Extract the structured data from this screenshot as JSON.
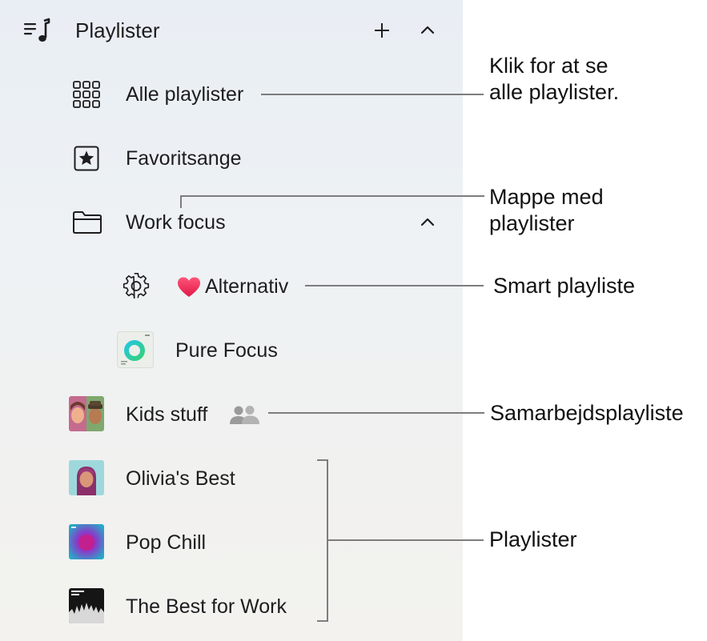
{
  "sidebar": {
    "title": "Playlister",
    "icons": {
      "header": "playlist-music-icon",
      "add": "plus-icon",
      "collapse": "chevron-up-icon"
    },
    "items": [
      {
        "label": "Alle playlister",
        "icon": "grid-icon"
      },
      {
        "label": "Favoritsange",
        "icon": "star-square-icon"
      },
      {
        "label": "Work focus",
        "icon": "folder-icon",
        "expanded": true
      },
      {
        "label": "Alternativ",
        "icon": "gear-icon",
        "badge": "heart-icon"
      },
      {
        "label": "Pure Focus",
        "icon": "pure-focus-artwork"
      },
      {
        "label": "Kids stuff",
        "icon": "kids-artwork",
        "badge": "people-icon"
      },
      {
        "label": "Olivia's Best",
        "icon": "olivia-artwork"
      },
      {
        "label": "Pop Chill",
        "icon": "pop-chill-artwork"
      },
      {
        "label": "The Best for Work",
        "icon": "best-for-work-artwork"
      }
    ]
  },
  "callouts": {
    "all_playlists": "Klik for at se\nalle playlister.",
    "folder": "Mappe med\nplaylister",
    "smart": "Smart playliste",
    "collab": "Samarbejdsplayliste",
    "playlists": "Playlister"
  },
  "colors": {
    "heart": "#f0285a",
    "callout_line": "#7d7d7d"
  }
}
